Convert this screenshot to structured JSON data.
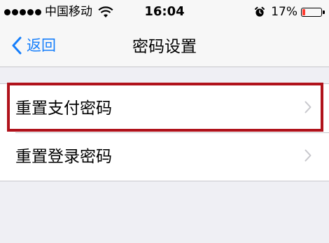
{
  "status_bar": {
    "carrier": "中国移动",
    "time": "16:04",
    "battery_percent": "17%",
    "battery_level": 0.17,
    "icons": [
      "signal-dots-icon",
      "wifi-icon",
      "alarm-icon",
      "battery-icon"
    ]
  },
  "nav": {
    "back_label": "返回",
    "title": "密码设置"
  },
  "list": {
    "items": [
      {
        "label": "重置支付密码",
        "highlighted": true
      },
      {
        "label": "重置登录密码",
        "highlighted": false
      }
    ]
  },
  "colors": {
    "accent": "#157efb",
    "highlight_border": "#b0121b",
    "battery_low": "#ff3b30",
    "background": "#efeff4"
  }
}
